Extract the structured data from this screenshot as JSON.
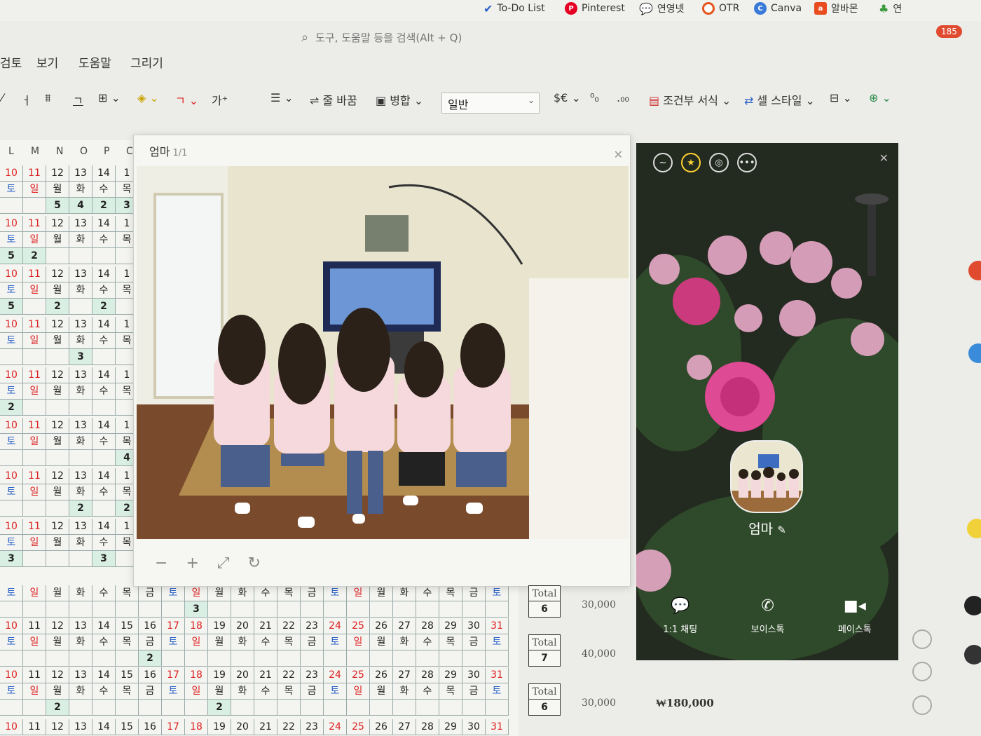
{
  "bookmarks": [
    {
      "label": "To-Do List",
      "icon": "check-icon"
    },
    {
      "label": "Pinterest",
      "icon": "pinterest-icon",
      "color": "#e60023"
    },
    {
      "label": "연영넷",
      "icon": "chat-icon"
    },
    {
      "label": "OTR",
      "icon": "otr-icon",
      "color": "#e5531a"
    },
    {
      "label": "Canva",
      "icon": "canva-icon",
      "color": "#3a7ad9"
    },
    {
      "label": "알바몬",
      "icon": "albamon-icon",
      "color": "#e84c1f"
    },
    {
      "label": "연",
      "icon": "leaf-icon",
      "color": "#3a9a3a"
    }
  ],
  "notification_count": "185",
  "search": {
    "placeholder": "도구, 도움말 등을 검색(Alt + Q)"
  },
  "menu": [
    "검토",
    "보기",
    "도움말",
    "그리기"
  ],
  "ribbon": {
    "wrap": "줄 바꿈",
    "merge": "병합",
    "format": "일반",
    "currency": "$€",
    "conditional": "조건부 서식",
    "cell_style": "셀 스타일"
  },
  "columns": [
    "L",
    "M",
    "N",
    "O",
    "P",
    "C"
  ],
  "dates_short": [
    "10",
    "11",
    "12",
    "13",
    "14",
    "1"
  ],
  "days_short": [
    "토",
    "일",
    "월",
    "화",
    "수",
    "목"
  ],
  "dates_full": [
    "10",
    "11",
    "12",
    "13",
    "14",
    "15",
    "16",
    "17",
    "18",
    "19",
    "20",
    "21",
    "22",
    "23",
    "24",
    "25",
    "26",
    "27",
    "28",
    "29",
    "30",
    "31"
  ],
  "days_full": [
    "토",
    "일",
    "월",
    "화",
    "수",
    "목",
    "금",
    "토",
    "일",
    "월",
    "화",
    "수",
    "목",
    "금",
    "토",
    "일",
    "월",
    "화",
    "수",
    "목",
    "금",
    "토"
  ],
  "blocks_short": [
    [
      "",
      "",
      "5",
      "4",
      "2",
      "3"
    ],
    [
      "5",
      "2",
      "",
      "",
      "",
      ""
    ],
    [
      "5",
      "",
      "2",
      "",
      "2",
      ""
    ],
    [
      "",
      "",
      "",
      "3",
      "",
      ""
    ],
    [
      "2",
      "",
      "",
      "",
      "",
      ""
    ],
    [
      "",
      "",
      "",
      "",
      "",
      "4"
    ],
    [
      "",
      "",
      "",
      "2",
      "",
      "2"
    ],
    [
      "3",
      "",
      "",
      "",
      "3",
      ""
    ]
  ],
  "blocks_full": [
    {
      "values": {
        "8": "3"
      },
      "total_label": "Total",
      "total": "6",
      "amount": "30,000"
    },
    {
      "values": {
        "6": "2"
      },
      "total_label": "Total",
      "total": "7",
      "amount": "40,000"
    },
    {
      "values": {
        "2": "2",
        "9": "2"
      },
      "total_label": "Total",
      "total": "6",
      "amount": "30,000"
    }
  ],
  "grand_total": "₩180,000",
  "viewer": {
    "title": "엄마",
    "count": "1/1"
  },
  "profile": {
    "name": "엄마",
    "actions": [
      {
        "label": "1:1 채팅",
        "icon": "chat-bubble-icon"
      },
      {
        "label": "보이스톡",
        "icon": "phone-icon"
      },
      {
        "label": "페이스톡",
        "icon": "video-icon"
      }
    ]
  }
}
